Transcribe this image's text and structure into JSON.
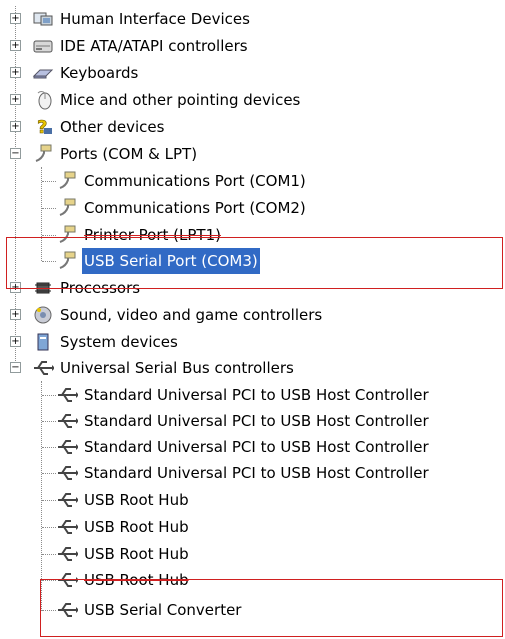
{
  "categories": [
    {
      "label": "Human Interface Devices",
      "icon": "hid-icon",
      "expanded": false
    },
    {
      "label": "IDE ATA/ATAPI controllers",
      "icon": "ide-controller-icon",
      "expanded": false
    },
    {
      "label": "Keyboards",
      "icon": "keyboard-icon",
      "expanded": false
    },
    {
      "label": "Mice and other pointing devices",
      "icon": "mouse-icon",
      "expanded": false
    },
    {
      "label": "Other devices",
      "icon": "question-mark-icon",
      "expanded": false
    },
    {
      "label": "Ports (COM & LPT)",
      "icon": "port-connector-icon",
      "expanded": true
    },
    {
      "label": "Processors",
      "icon": "processor-icon",
      "expanded": false
    },
    {
      "label": "Sound, video and game controllers",
      "icon": "sound-icon",
      "expanded": false
    },
    {
      "label": "System devices",
      "icon": "system-device-icon",
      "expanded": false
    },
    {
      "label": "Universal Serial Bus controllers",
      "icon": "usb-icon",
      "expanded": true
    }
  ],
  "ports_children": [
    "Communications Port (COM1)",
    "Communications Port (COM2)",
    "Printer Port (LPT1)",
    "USB Serial Port (COM3)"
  ],
  "usb_children": [
    "Standard Universal PCI to USB Host Controller",
    "Standard Universal PCI to USB Host Controller",
    "Standard Universal PCI to USB Host Controller",
    "Standard Universal PCI to USB Host Controller",
    "USB Root Hub",
    "USB Root Hub",
    "USB Root Hub",
    "USB Root Hub",
    "USB Serial Converter"
  ],
  "selected": "USB Serial Port (COM3)",
  "expander_symbols": {
    "collapsed": "+",
    "expanded": "−"
  },
  "colors": {
    "highlight": "#316ac5",
    "annotation": "#d02020",
    "tree_line": "#8c8c8c"
  }
}
